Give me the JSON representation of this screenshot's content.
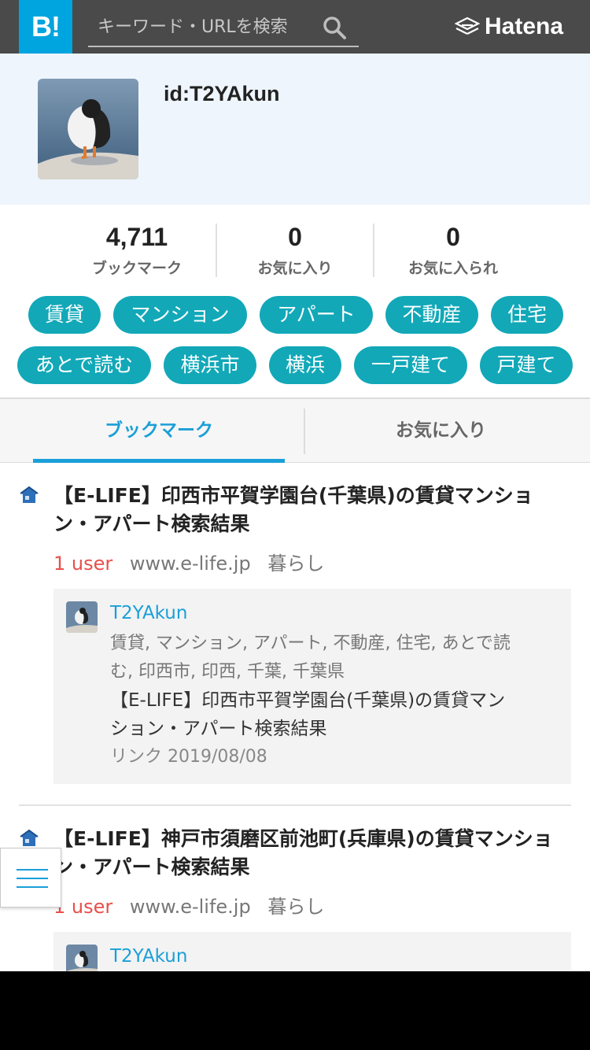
{
  "header": {
    "logo_text": "B!",
    "search_placeholder": "キーワード・URLを検索",
    "brand": "Hatena"
  },
  "profile": {
    "user_id": "id:T2YAkun"
  },
  "stats": [
    {
      "value": "4,711",
      "label": "ブックマーク"
    },
    {
      "value": "0",
      "label": "お気に入り"
    },
    {
      "value": "0",
      "label": "お気に入られ"
    }
  ],
  "tags": [
    "賃貸",
    "マンション",
    "アパート",
    "不動産",
    "住宅",
    "あとで読む",
    "横浜市",
    "横浜",
    "一戸建て",
    "戸建て"
  ],
  "tabs": {
    "bookmarks": "ブックマーク",
    "favorites": "お気に入り"
  },
  "entries": [
    {
      "title": "【E-LIFE】印西市平賀学園台(千葉県)の賃貸マンション・アパート検索結果",
      "users": "1 user",
      "domain": "www.e-life.jp",
      "category": "暮らし",
      "comment": {
        "user": "T2YAkun",
        "tags": "賃貸, マンション, アパート, 不動産, 住宅, あとで読む, 印西市, 印西, 千葉, 千葉県",
        "text": "【E-LIFE】印西市平賀学園台(千葉県)の賃貸マンション・アパート検索結果",
        "date": "リンク 2019/08/08"
      }
    },
    {
      "title": "【E-LIFE】神戸市須磨区前池町(兵庫県)の賃貸マンション・アパート検索結果",
      "users": "1 user",
      "domain": "www.e-life.jp",
      "category": "暮らし",
      "comment": {
        "user": "T2YAkun"
      }
    }
  ],
  "colors": {
    "accent": "#1a9fd8",
    "tag_bg": "#12a8b8",
    "users": "#e8504a",
    "header_bg": "#4a4a4a",
    "logo_bg": "#00a4de"
  }
}
